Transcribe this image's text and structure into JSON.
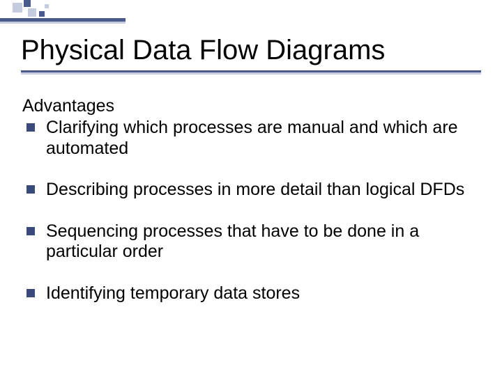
{
  "decor": {
    "bar_color": "#4a5a8a",
    "bar_light_color": "#c5cce0"
  },
  "title": "Physical Data Flow Diagrams",
  "subheading": "Advantages",
  "bullets": [
    "Clarifying which processes are manual and which are automated",
    "Describing processes in more detail than logical DFDs",
    "Sequencing processes that have to be done in a particular order",
    "Identifying temporary data stores"
  ]
}
